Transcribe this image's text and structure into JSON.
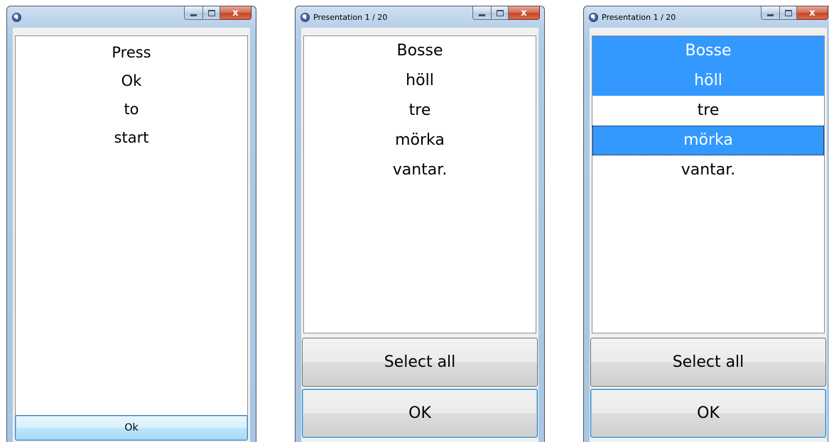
{
  "windows": [
    {
      "title": "",
      "start_lines": [
        "Press",
        "Ok",
        "to",
        "start"
      ],
      "ok_label": "Ok"
    },
    {
      "title": "Presentation 1 / 20",
      "words": [
        "Bosse",
        "höll",
        "tre",
        "mörka",
        "vantar."
      ],
      "select_all_label": "Select all",
      "ok_label": "OK"
    },
    {
      "title": "Presentation 1 / 20",
      "words": [
        "Bosse",
        "höll",
        "tre",
        "mörka",
        "vantar."
      ],
      "selected_words": [
        "Bosse",
        "höll",
        "mörka"
      ],
      "focused_word": "mörka",
      "select_all_label": "Select all",
      "ok_label": "OK"
    }
  ],
  "caption_buttons": {
    "close_glyph": "x"
  },
  "colors": {
    "selection": "#3399ff",
    "selection_text": "#ffffff",
    "default_button_border": "#3c7fb1"
  }
}
